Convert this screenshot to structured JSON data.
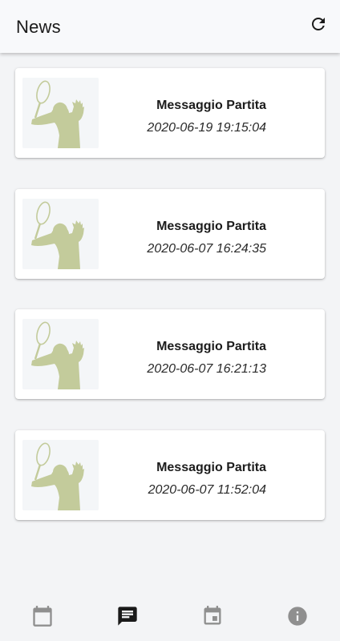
{
  "app_bar": {
    "title": "News",
    "refresh_icon": "refresh-icon"
  },
  "news": [
    {
      "title": "Messaggio Partita",
      "date": "2020-06-19 19:15:04",
      "thumbnail_icon": "tennis-player-icon"
    },
    {
      "title": "Messaggio Partita",
      "date": "2020-06-07 16:24:35",
      "thumbnail_icon": "tennis-player-icon"
    },
    {
      "title": "Messaggio Partita",
      "date": "2020-06-07 16:21:13",
      "thumbnail_icon": "tennis-player-icon"
    },
    {
      "title": "Messaggio Partita",
      "date": "2020-06-07 11:52:04",
      "thumbnail_icon": "tennis-player-icon"
    }
  ],
  "bottom_nav": {
    "items": [
      {
        "icon": "calendar-icon",
        "active": false
      },
      {
        "icon": "message-icon",
        "active": true
      },
      {
        "icon": "event-icon",
        "active": false
      },
      {
        "icon": "info-icon",
        "active": false
      }
    ]
  },
  "colors": {
    "thumbnail_silhouette": "#c3cb9b",
    "active_nav": "#1a1a1a",
    "inactive_nav": "#8f8f8f"
  }
}
